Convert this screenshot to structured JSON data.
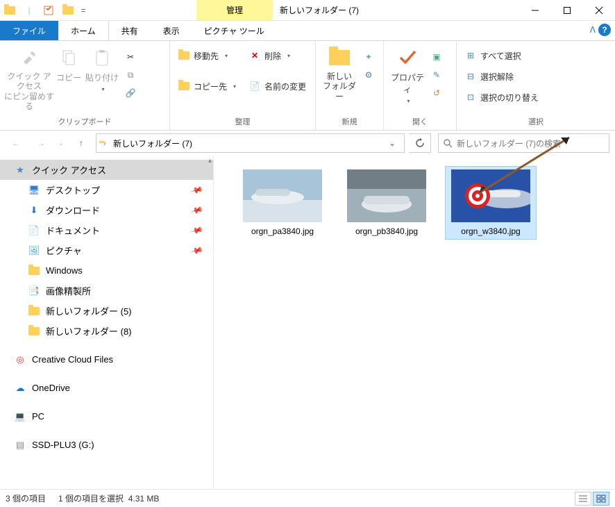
{
  "title_tab": "管理",
  "window_title": "新しいフォルダー (7)",
  "tabs": {
    "file": "ファイル",
    "home": "ホーム",
    "share": "共有",
    "view": "表示",
    "context": "ピクチャ ツール"
  },
  "ribbon": {
    "clipboard": {
      "label": "クリップボード",
      "pin": "クイック アクセス\nにピン留めする",
      "copy": "コピー",
      "paste": "貼り付け"
    },
    "organize": {
      "label": "整理",
      "move_to": "移動先",
      "copy_to": "コピー先",
      "delete": "削除",
      "rename": "名前の変更"
    },
    "new": {
      "label": "新規",
      "new_folder": "新しい\nフォルダー"
    },
    "open": {
      "label": "開く",
      "properties": "プロパティ"
    },
    "select": {
      "label": "選択",
      "select_all": "すべて選択",
      "select_none": "選択解除",
      "invert": "選択の切り替え"
    }
  },
  "breadcrumb": {
    "current": "新しいフォルダー (7)"
  },
  "search_placeholder": "新しいフォルダー (7)の検索",
  "sidebar": {
    "quick_access": "クイック アクセス",
    "desktop": "デスクトップ",
    "downloads": "ダウンロード",
    "documents": "ドキュメント",
    "pictures": "ピクチャ",
    "windows": "Windows",
    "refinery": "画像精製所",
    "nf5": "新しいフォルダー (5)",
    "nf8": "新しいフォルダー (8)",
    "ccf": "Creative Cloud Files",
    "onedrive": "OneDrive",
    "pc": "PC",
    "ssd": "SSD-PLU3 (G:)"
  },
  "files": [
    {
      "name": "orgn_pa3840.jpg"
    },
    {
      "name": "orgn_pb3840.jpg"
    },
    {
      "name": "orgn_w3840.jpg"
    }
  ],
  "status": {
    "count": "3 個の項目",
    "selection": "1 個の項目を選択",
    "size": "4.31 MB"
  }
}
